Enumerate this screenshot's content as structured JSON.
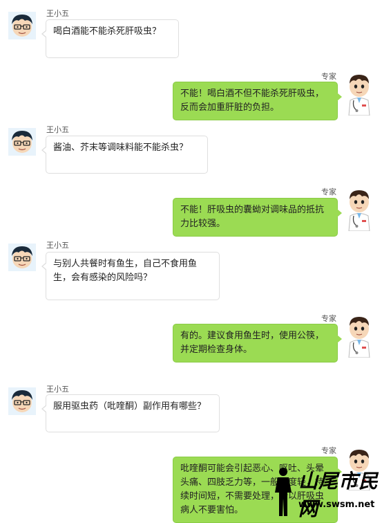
{
  "user_name": "王小五",
  "expert_name": "专家",
  "watermark": {
    "title": "山尾市民网",
    "url": "www.swsm.net"
  },
  "messages": [
    {
      "from": "user",
      "text": "喝白酒能不能杀死肝吸虫？"
    },
    {
      "from": "expert",
      "text": "不能！喝白酒不但不能杀死肝吸虫，反而会加重肝脏的负担。"
    },
    {
      "from": "user",
      "text": "酱油、芥末等调味料能不能杀虫？"
    },
    {
      "from": "expert",
      "text": "不能！肝吸虫的囊蚴对调味品的抵抗力比较强。"
    },
    {
      "from": "user",
      "text": "与别人共餐时有鱼生，自己不食用鱼生，会有感染的风险吗？"
    },
    {
      "from": "expert",
      "text": "有的。建议食用鱼生时，使用公筷，并定期检查身体。"
    },
    {
      "from": "user",
      "text": "服用驱虫药（吡喹酮）副作用有哪些？"
    },
    {
      "from": "expert",
      "text": "吡喹酮可能会引起恶心、呕吐、头晕头痛、四肢乏力等，一般程度轻，持续时间短，不需要处理，所以肝吸虫病人不要害怕。"
    }
  ],
  "colors": {
    "expert_bubble": "#9bdb53",
    "user_bubble": "#ffffff"
  }
}
